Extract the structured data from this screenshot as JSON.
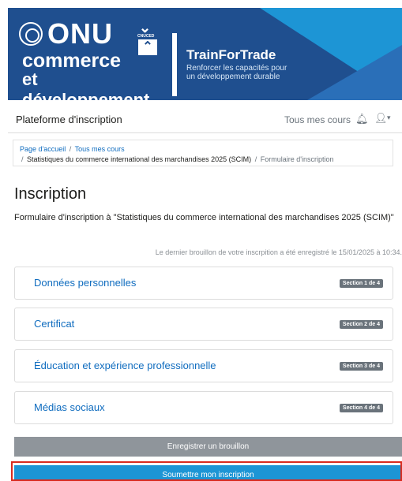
{
  "banner": {
    "onu": "ONU",
    "cnuced": "CNUCED",
    "commerce": "commerce",
    "et_developpement": "et développement",
    "trainfortrade": "TrainForTrade",
    "tagline_line1": "Renforcer les capacités pour",
    "tagline_line2": "un développement durable"
  },
  "nav": {
    "site_name": "Plateforme d'inscription",
    "my_courses": "Tous mes cours",
    "bell_icon": "bell-icon",
    "user_icon": "user-icon",
    "caret_icon": "chevron-down-icon"
  },
  "breadcrumb": {
    "home": "Page d'accueil",
    "sep": "/",
    "all_courses": "Tous mes cours",
    "course": "Statistiques du commerce international des marchandises 2025 (SCIM)",
    "form": "Formulaire d'inscription"
  },
  "page": {
    "title": "Inscription",
    "intro": "Formulaire d'inscription à \"Statistiques du commerce international des marchandises 2025 (SCIM)\"",
    "draft_info": "Le dernier brouillon de votre inscrpition a été enregistré le 15/01/2025 à 10:34."
  },
  "sections": [
    {
      "title": "Données personnelles",
      "badge": "Section 1 de 4"
    },
    {
      "title": "Certificat",
      "badge": "Section 2 de 4"
    },
    {
      "title": "Éducation et expérience professionnelle",
      "badge": "Section 3 de 4"
    },
    {
      "title": "Médias sociaux",
      "badge": "Section 4 de 4"
    }
  ],
  "buttons": {
    "save_draft": "Enregistrer un brouillon",
    "submit": "Soumettre mon inscription"
  },
  "colors": {
    "banner_blue": "#1f4f8f",
    "accent_blue": "#1d95d5",
    "link_blue": "#0f6cbf",
    "highlight_red": "#d92b1f"
  }
}
